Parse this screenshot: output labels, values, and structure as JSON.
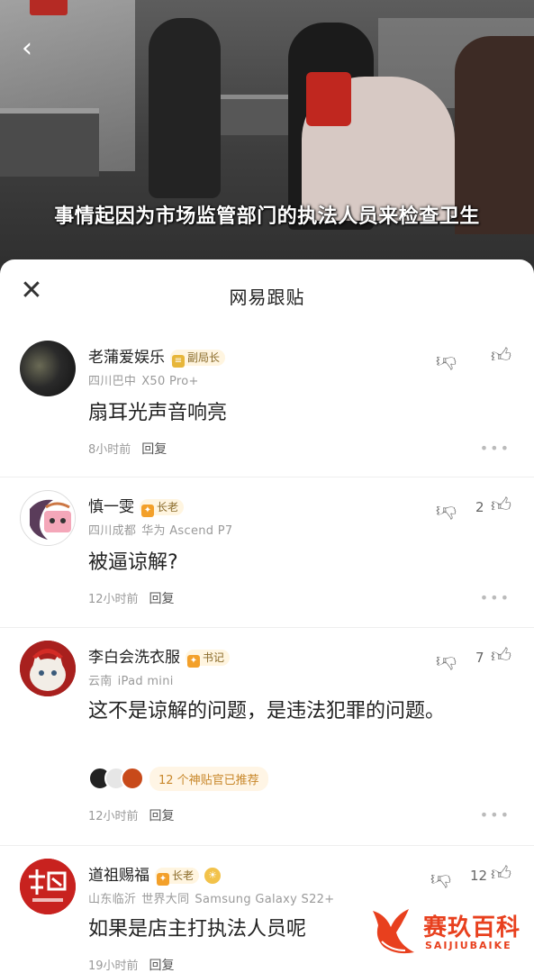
{
  "video": {
    "caption": "事情起因为市场监管部门的执法人员来检查卫生",
    "back_icon": "chevron-left-icon"
  },
  "sheet": {
    "title": "网易跟贴",
    "close_icon": "close-icon"
  },
  "comments": [
    {
      "name": "老蒲爱娱乐",
      "badge": "副局长",
      "location": "四川巴中",
      "device": "X50 Pro+",
      "content": "扇耳光声音响亮",
      "time": "8小时前",
      "reply": "回复",
      "likes": ""
    },
    {
      "name": "慎一雯",
      "badge": "长老",
      "location": "四川成都",
      "device": "华为 Ascend P7",
      "content": "被逼谅解?",
      "time": "12小时前",
      "reply": "回复",
      "likes": "2"
    },
    {
      "name": "李白会洗衣服",
      "badge": "书记",
      "location": "云南",
      "device": "iPad mini",
      "content": "这不是谅解的问题，是违法犯罪的问题。",
      "recommend": "12 个神贴官已推荐",
      "time": "12小时前",
      "reply": "回复",
      "likes": "7"
    },
    {
      "name": "道祖赐福",
      "badge": "长老",
      "location": "山东临沂",
      "device_extra": "世界大同",
      "device": "Samsung Galaxy S22+",
      "content": "如果是店主打执法人员呢",
      "time": "19小时前",
      "reply": "回复",
      "likes": "12"
    }
  ],
  "watermark": {
    "text": "赛玖百科",
    "sub": "SAIJIUBAIKE"
  },
  "colors": {
    "accent_orange": "#f3a02a",
    "watermark_red": "#e8401e"
  }
}
